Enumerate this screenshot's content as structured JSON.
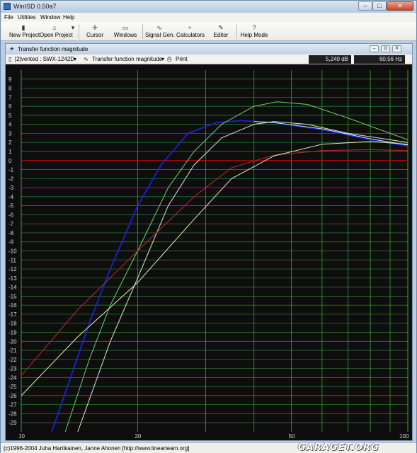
{
  "app": {
    "title": "WinISD 0.50a7",
    "window_controls": {
      "minimize": "–",
      "maximize": "□",
      "close": "✕"
    }
  },
  "menu": [
    "File",
    "Utilities",
    "Window",
    "Help"
  ],
  "toolbar": [
    {
      "label": "New Project",
      "icon": "new-project-icon"
    },
    {
      "label": "Open Project",
      "icon": "open-project-icon"
    },
    {
      "label": "Cursor",
      "icon": "cursor-icon"
    },
    {
      "label": "Windows",
      "icon": "windows-icon"
    },
    {
      "label": "Signal Gen.",
      "icon": "signal-gen-icon"
    },
    {
      "label": "Calculators",
      "icon": "calculators-icon"
    },
    {
      "label": "Editor",
      "icon": "editor-icon"
    },
    {
      "label": "Help Mode",
      "icon": "help-mode-icon"
    }
  ],
  "graph_window": {
    "title": "Transfer function magnitude",
    "project_select": "[2]vented : SWX-1242D",
    "graph_select": "Transfer function magnitude",
    "print_label": "Print",
    "readout_db": "5,240 dB",
    "readout_hz": "60,56 Hz"
  },
  "status": {
    "text": "(c)1996-2004 Juha Hartikainen, Janne Ahonen [http://www.linearteam.org]",
    "watermark": "GARAGET.ORG"
  },
  "chart_data": {
    "type": "line",
    "x_scale": "log",
    "xlim": [
      10,
      100
    ],
    "ylim": [
      -30,
      10
    ],
    "x_tick_labels": [
      "10",
      "20",
      "50",
      "100"
    ],
    "y_tick_labels": [
      "9",
      "8",
      "7",
      "6",
      "5",
      "4",
      "3",
      "2",
      "1",
      "0",
      "-1",
      "-2",
      "-3",
      "-4",
      "-5",
      "-6",
      "-7",
      "-8",
      "-9",
      "-10",
      "-11",
      "-12",
      "-13",
      "-14",
      "-15",
      "-16",
      "-17",
      "-18",
      "-19",
      "-20",
      "-21",
      "-22",
      "-23",
      "-24",
      "-25",
      "-26",
      "-27",
      "-28",
      "-29"
    ],
    "grid": true,
    "reference_lines": [
      {
        "y": 0,
        "color": "#c00000"
      },
      {
        "y": -3,
        "color": "#b0006a"
      }
    ],
    "series": [
      {
        "color": "#1a22d8",
        "x": [
          12,
          15,
          17,
          20,
          23,
          27,
          32,
          37,
          45,
          60,
          80,
          100
        ],
        "y": [
          -30,
          -18,
          -12,
          -5,
          -0.5,
          3,
          4.2,
          4.4,
          4.2,
          3.4,
          2.3,
          1.6
        ]
      },
      {
        "color": "#cfd8ff",
        "x": [
          40,
          45,
          60,
          80,
          100
        ],
        "y": [
          4.3,
          4.2,
          3.5,
          2.4,
          1.7
        ]
      },
      {
        "color": "#6fd26f",
        "x": [
          13,
          15,
          17,
          20,
          24,
          28,
          33,
          40,
          46,
          55,
          70,
          100
        ],
        "y": [
          -30,
          -22,
          -16,
          -10,
          -3,
          1,
          4,
          6,
          6.5,
          6.2,
          4.7,
          2.3
        ]
      },
      {
        "color": "#d8f0d0",
        "x": [
          14,
          17,
          20,
          24,
          28,
          33,
          40,
          45,
          55,
          70,
          100
        ],
        "y": [
          -30,
          -20,
          -13,
          -5,
          -0.5,
          2.5,
          4,
          4.3,
          4,
          3,
          2
        ]
      },
      {
        "color": "#c8242a",
        "x": [
          10,
          14,
          20,
          28,
          35,
          45,
          60,
          80,
          100
        ],
        "y": [
          -23.8,
          -16.5,
          -10,
          -4,
          -0.8,
          0.6,
          1.1,
          1.2,
          1.1
        ]
      },
      {
        "color": "#e8e8c0",
        "x": [
          10,
          14,
          20,
          28,
          35,
          45,
          60,
          80,
          100
        ],
        "y": [
          -26,
          -19.5,
          -13.5,
          -6.5,
          -2,
          0.5,
          1.8,
          2.1,
          1.8
        ]
      }
    ]
  }
}
